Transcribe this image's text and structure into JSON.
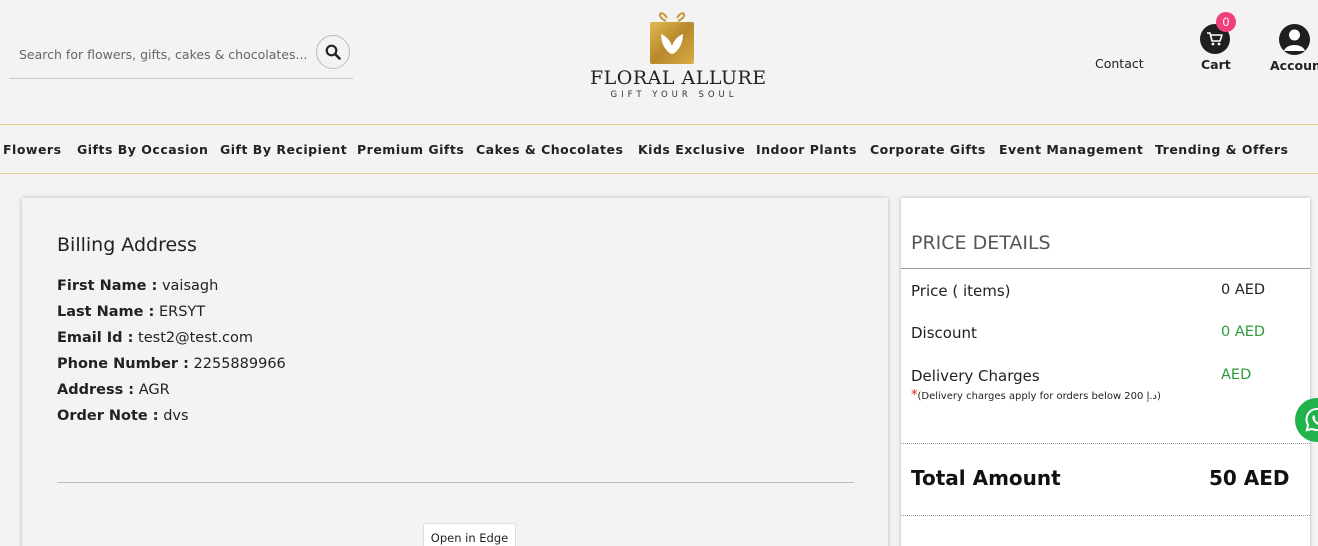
{
  "header": {
    "search": {
      "placeholder": "Search for flowers, gifts, cakes & chocolates..."
    },
    "logo": {
      "name": "FLORAL ALLURE",
      "tagline": "GIFT YOUR SOUL"
    },
    "contact_label": "Contact",
    "cart_label": "Cart",
    "cart_count": "0",
    "account_label": "Account"
  },
  "nav": {
    "items": [
      "Flowers",
      "Gifts By Occasion",
      "Gift By Recipient",
      "Premium Gifts",
      "Cakes & Chocolates",
      "Kids Exclusive",
      "Indoor Plants",
      "Corporate Gifts",
      "Event Management",
      "Trending & Offers"
    ]
  },
  "billing": {
    "title": "Billing Address",
    "fields": [
      {
        "label": "First Name :",
        "value": "vaisagh"
      },
      {
        "label": "Last Name :",
        "value": "ERSYT"
      },
      {
        "label": "Email Id :",
        "value": "test2@test.com"
      },
      {
        "label": "Phone Number :",
        "value": "2255889966"
      },
      {
        "label": "Address :",
        "value": "AGR"
      },
      {
        "label": "Order Note :",
        "value": "dvs"
      }
    ],
    "edge_button": "Open in Edge"
  },
  "price_details": {
    "title": "PRICE DETAILS",
    "rows": [
      {
        "label": "Price ( items)",
        "value": "0 AED"
      },
      {
        "label": "Discount",
        "value": "0 AED"
      },
      {
        "label": "Delivery Charges",
        "value": "AED"
      }
    ],
    "note_asterisk": "*",
    "note": "(Delivery charges apply for orders below 200 د.إ)",
    "total_label": "Total Amount",
    "total_value": "50 AED"
  },
  "colors": {
    "gold": "#c9a33a",
    "nav_border": "#e3cf8c",
    "badge": "#f0407a",
    "green": "#2e9a3a",
    "whatsapp": "#22b24c"
  },
  "icons": [
    "search-icon",
    "logo-gift-icon",
    "cart-icon",
    "account-icon",
    "whatsapp-icon"
  ]
}
